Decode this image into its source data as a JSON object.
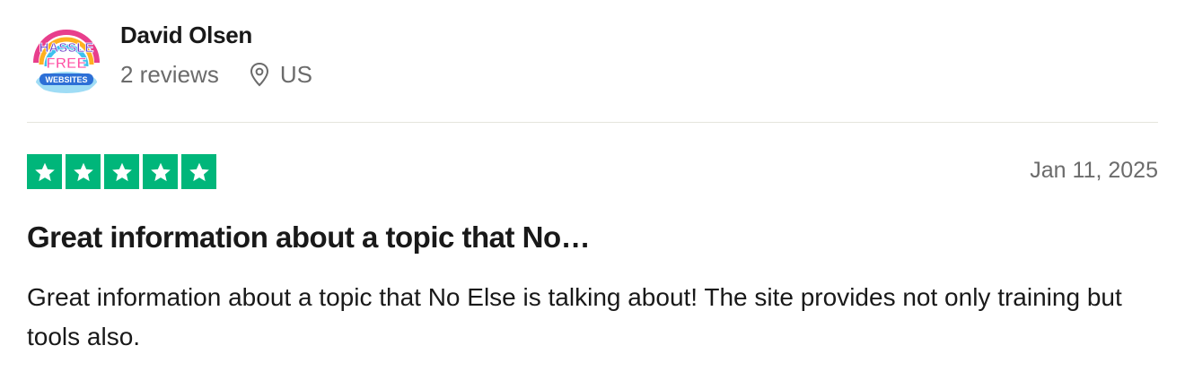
{
  "reviewer": {
    "name": "David Olsen",
    "reviews_count": "2 reviews",
    "location": "US",
    "avatar_logo": {
      "line1": "HASSLE",
      "line2": "FREE",
      "line3": "WEBSITES"
    }
  },
  "review": {
    "rating": 5,
    "max_rating": 5,
    "star_color": "#00b67a",
    "date": "Jan 11, 2025",
    "title": "Great information about a topic that No…",
    "body": "Great information about a topic that No Else is talking about! The site provides not only training but tools also."
  },
  "icons": {
    "location": "map-pin-icon",
    "star": "star-icon"
  }
}
